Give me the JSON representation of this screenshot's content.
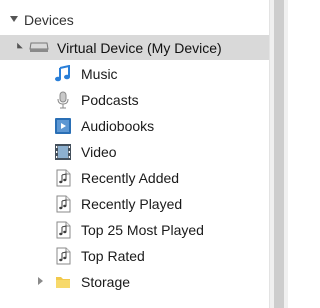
{
  "section": {
    "label": "Devices"
  },
  "device": {
    "label": "Virtual Device (My Device)"
  },
  "items": [
    {
      "label": "Music",
      "icon": "music-note-icon"
    },
    {
      "label": "Podcasts",
      "icon": "microphone-icon"
    },
    {
      "label": "Audiobooks",
      "icon": "audiobook-icon"
    },
    {
      "label": "Video",
      "icon": "film-icon"
    },
    {
      "label": "Recently Added",
      "icon": "playlist-icon"
    },
    {
      "label": "Recently Played",
      "icon": "playlist-icon"
    },
    {
      "label": "Top 25 Most Played",
      "icon": "playlist-icon"
    },
    {
      "label": "Top Rated",
      "icon": "playlist-icon"
    },
    {
      "label": "Storage",
      "icon": "folder-icon"
    }
  ],
  "colors": {
    "selection": "#d9d9d9",
    "music": "#2a7fd8",
    "audiobook": "#2a6fb5",
    "folder": "#f2c94c"
  }
}
